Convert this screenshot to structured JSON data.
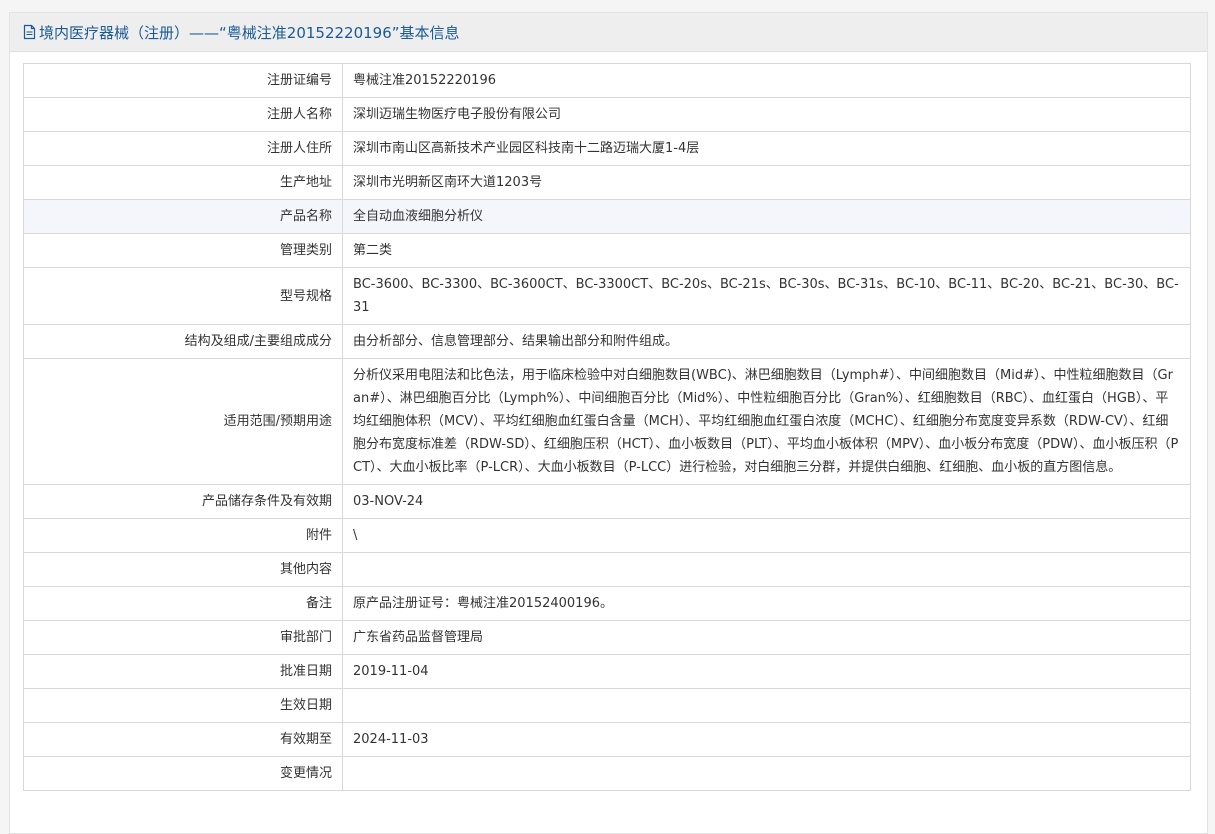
{
  "header": {
    "icon": "document-icon",
    "title": "境内医疗器械（注册）——“粤械注准20152220196”基本信息",
    "color": "#1a5a96"
  },
  "rows": [
    {
      "label": "注册证编号",
      "value": "粤械注准20152220196"
    },
    {
      "label": "注册人名称",
      "value": "深圳迈瑞生物医疗电子股份有限公司"
    },
    {
      "label": "注册人住所",
      "value": "深圳市南山区高新技术产业园区科技南十二路迈瑞大厦1-4层"
    },
    {
      "label": "生产地址",
      "value": "深圳市光明新区南环大道1203号"
    },
    {
      "label": "产品名称",
      "value": "全自动血液细胞分析仪"
    },
    {
      "label": "管理类别",
      "value": "第二类"
    },
    {
      "label": "型号规格",
      "value": "BC-3600、BC-3300、BC-3600CT、BC-3300CT、BC-20s、BC-21s、BC-30s、BC-31s、BC-10、BC-11、BC-20、BC-21、BC-30、BC-31"
    },
    {
      "label": "结构及组成/主要组成成分",
      "value": "由分析部分、信息管理部分、结果输出部分和附件组成。"
    },
    {
      "label": "适用范围/预期用途",
      "value": "分析仪采用电阻法和比色法，用于临床检验中对白细胞数目(WBC)、淋巴细胞数目（Lymph#）、中间细胞数目（Mid#）、中性粒细胞数目（Gran#）、淋巴细胞百分比（Lymph%）、中间细胞百分比（Mid%）、中性粒细胞百分比（Gran%）、红细胞数目（RBC）、血红蛋白（HGB）、平均红细胞体积（MCV）、平均红细胞血红蛋白含量（MCH）、平均红细胞血红蛋白浓度（MCHC）、红细胞分布宽度变异系数（RDW-CV）、红细胞分布宽度标准差（RDW-SD）、红细胞压积（HCT）、血小板数目（PLT）、平均血小板体积（MPV）、血小板分布宽度（PDW）、血小板压积（PCT）、大血小板比率（P-LCR）、大血小板数目（P-LCC）进行检验，对白细胞三分群，并提供白细胞、红细胞、血小板的直方图信息。"
    },
    {
      "label": "产品储存条件及有效期",
      "value": "03-NOV-24"
    },
    {
      "label": "附件",
      "value": "\\"
    },
    {
      "label": "其他内容",
      "value": ""
    },
    {
      "label": "备注",
      "value": "原产品注册证号：粤械注准20152400196。"
    },
    {
      "label": "审批部门",
      "value": "广东省药品监督管理局"
    },
    {
      "label": "批准日期",
      "value": "2019-11-04"
    },
    {
      "label": "生效日期",
      "value": ""
    },
    {
      "label": "有效期至",
      "value": "2024-11-03"
    },
    {
      "label": "变更情况",
      "value": ""
    }
  ]
}
